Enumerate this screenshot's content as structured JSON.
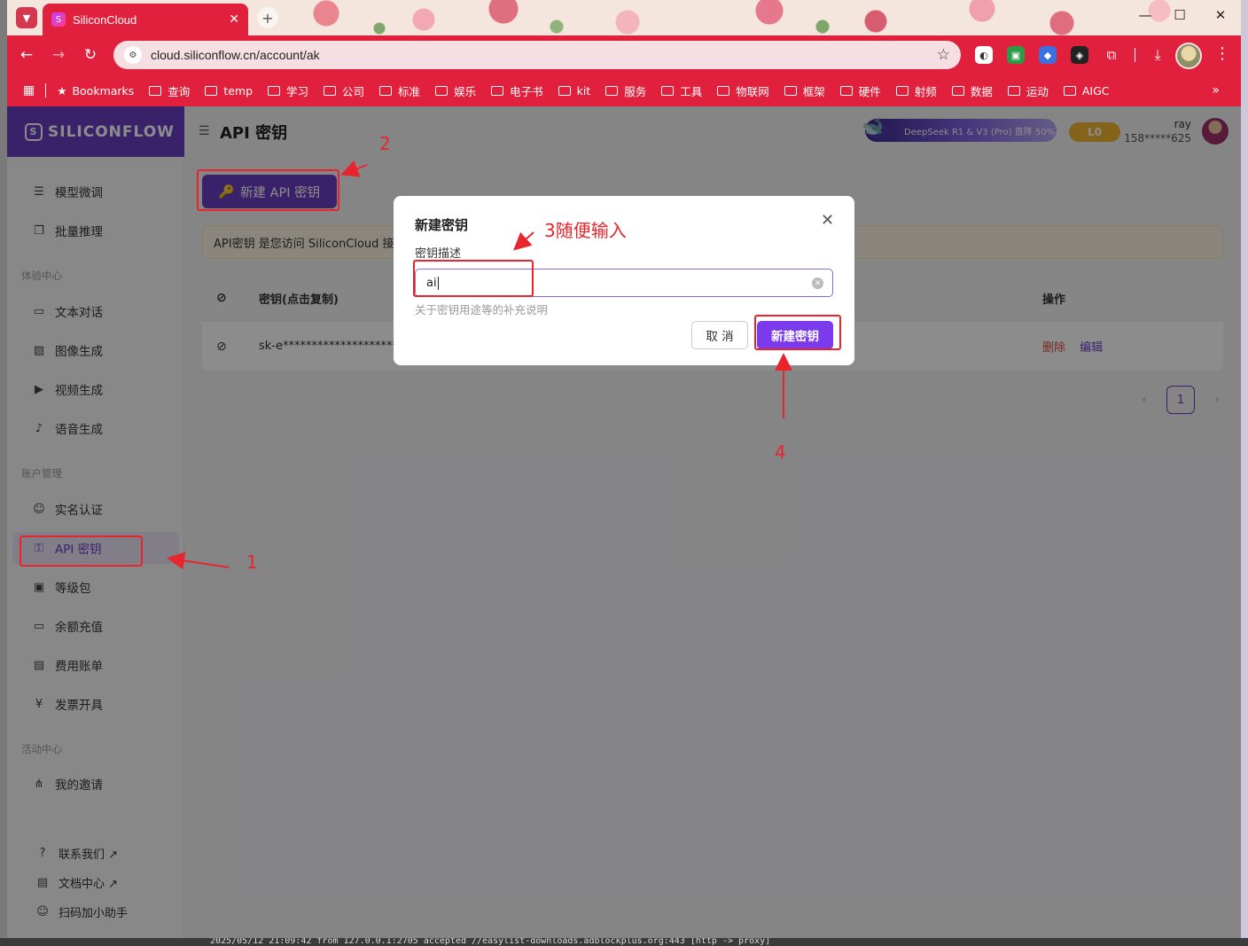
{
  "browser": {
    "tab_title": "SiliconCloud",
    "url": "cloud.siliconflow.cn/account/ak",
    "bookmarks": [
      "Bookmarks",
      "查询",
      "temp",
      "学习",
      "公司",
      "标准",
      "娱乐",
      "电子书",
      "kit",
      "服务",
      "工具",
      "物联网",
      "框架",
      "硬件",
      "射频",
      "数据",
      "运动",
      "AIGC"
    ]
  },
  "brand": {
    "name": "SILICONFLOW"
  },
  "sidebar": {
    "top_items": [
      {
        "label": "模型微调",
        "icon": "sliders-icon"
      },
      {
        "label": "批量推理",
        "icon": "copy-icon"
      }
    ],
    "groups": [
      {
        "title": "体验中心",
        "items": [
          {
            "label": "文本对话",
            "icon": "chat-icon"
          },
          {
            "label": "图像生成",
            "icon": "image-icon"
          },
          {
            "label": "视频生成",
            "icon": "video-icon"
          },
          {
            "label": "语音生成",
            "icon": "mic-icon"
          }
        ]
      },
      {
        "title": "账户管理",
        "items": [
          {
            "label": "实名认证",
            "icon": "user-check-icon"
          },
          {
            "label": "API 密钥",
            "icon": "key-icon"
          },
          {
            "label": "等级包",
            "icon": "wallet-icon"
          },
          {
            "label": "余额充值",
            "icon": "card-icon"
          },
          {
            "label": "费用账单",
            "icon": "bill-icon"
          },
          {
            "label": "发票开具",
            "icon": "invoice-icon"
          }
        ]
      },
      {
        "title": "活动中心",
        "items": [
          {
            "label": "我的邀请",
            "icon": "share-icon"
          }
        ]
      }
    ],
    "footer": [
      {
        "label": "联系我们 ↗",
        "icon": "help-icon"
      },
      {
        "label": "文档中心 ↗",
        "icon": "doc-icon"
      },
      {
        "label": "扫码加小助手",
        "icon": "people-icon"
      }
    ]
  },
  "header": {
    "title": "API 密钥",
    "promo": "DeepSeek R1 & V3 (Pro) 直降 50%",
    "level": "L0",
    "user_name": "ray",
    "user_phone": "158*****625"
  },
  "main": {
    "new_key_button": "新建 API 密钥",
    "notice": "API密钥 是您访问 SiliconCloud 接",
    "table": {
      "headers": [
        "密钥(点击复制)",
        "操作"
      ],
      "rows": [
        {
          "key": "sk-e**********************",
          "ops": [
            "删除",
            "编辑"
          ]
        }
      ]
    },
    "pagination": {
      "current": "1"
    }
  },
  "modal": {
    "title": "新建密钥",
    "field_label": "密钥描述",
    "field_value": "ai",
    "hint": "关于密钥用途等的补充说明",
    "cancel": "取 消",
    "confirm": "新建密钥"
  },
  "annotations": {
    "step1": "1",
    "step2": "2",
    "step3": "3随便输入",
    "step4": "4",
    "color": "#e8252c"
  },
  "colors": {
    "browser_accent": "#e0203d",
    "brand_purple": "#6a3fc4",
    "confirm_purple": "#7c3aed"
  },
  "desktop": {
    "log_line": "2025/05/12 21:09:42 from 127.0.0.1:2705 accepted //easylist-downloads.adblockplus.org:443 [http -> proxy]"
  }
}
